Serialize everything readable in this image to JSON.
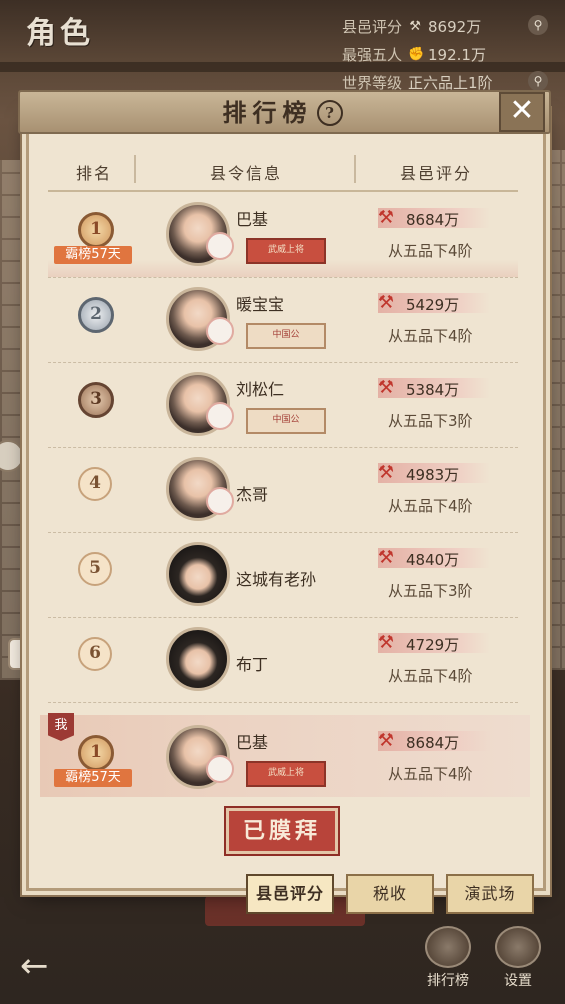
{
  "screen": {
    "title": "角色",
    "stats": [
      {
        "label": "县邑评分",
        "icon": "hammer-icon",
        "value": "8692万"
      },
      {
        "label": "最强五人",
        "icon": "fist-icon",
        "value": "192.1万"
      },
      {
        "label": "世界等级",
        "icon": "",
        "value": "正六品上1阶"
      }
    ]
  },
  "modal": {
    "title": "排行榜",
    "help": "?",
    "close": "✕",
    "columns": [
      "排名",
      "县令信息",
      "县邑评分"
    ],
    "rows": [
      {
        "rank": "1",
        "name": "巴基",
        "score": "8684万",
        "grade": "从五品下4阶",
        "streak": "霸榜57天",
        "badge": "武威上将"
      },
      {
        "rank": "2",
        "name": "暖宝宝",
        "score": "5429万",
        "grade": "从五品下4阶",
        "badge": "中国公"
      },
      {
        "rank": "3",
        "name": "刘松仁",
        "score": "5384万",
        "grade": "从五品下3阶",
        "badge": "中国公"
      },
      {
        "rank": "4",
        "name": "杰哥",
        "score": "4983万",
        "grade": "从五品下4阶"
      },
      {
        "rank": "5",
        "name": "这城有老孙",
        "score": "4840万",
        "grade": "从五品下3阶"
      },
      {
        "rank": "6",
        "name": "布丁",
        "score": "4729万",
        "grade": "从五品下4阶"
      }
    ],
    "me": {
      "tag": "我",
      "rank": "1",
      "name": "巴基",
      "score": "8684万",
      "grade": "从五品下4阶",
      "streak": "霸榜57天",
      "badge": "武威上将"
    },
    "worship_button": "已膜拜",
    "tabs": [
      "县邑评分",
      "税收",
      "演武场"
    ]
  },
  "bottom_bar": {
    "back": "←",
    "leaderboard": "排行榜",
    "settings": "设置"
  },
  "colors": {
    "accent_red": "#b8443a",
    "streak_orange": "#e0753f",
    "panel": "#efe4d1"
  }
}
